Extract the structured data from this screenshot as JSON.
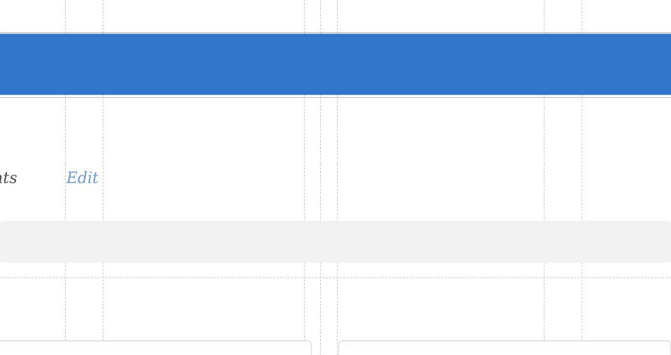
{
  "header": {
    "background_color": "#3276cc"
  },
  "content_row": {
    "label_text": "nts",
    "edit_label": "Edit"
  },
  "bands": {
    "grey_color": "#f2f2f2"
  }
}
